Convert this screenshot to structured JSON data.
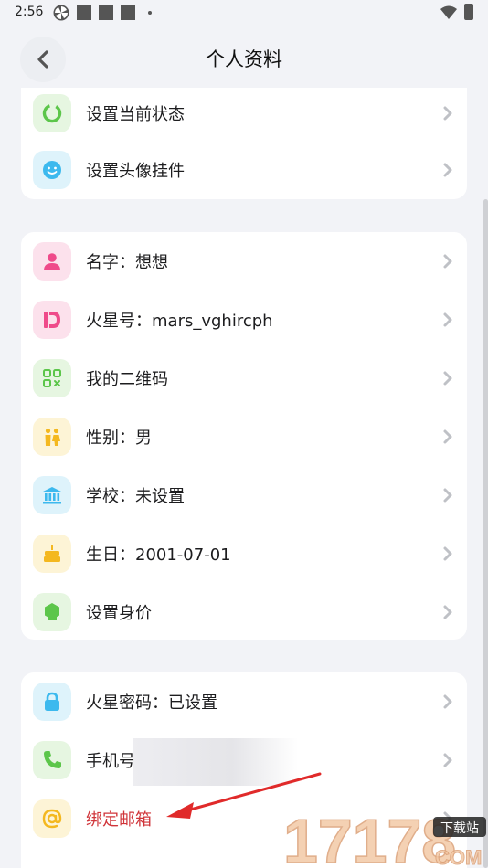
{
  "status_bar": {
    "time": "2:56"
  },
  "header": {
    "title": "个人资料"
  },
  "cards": {
    "status": [
      {
        "label": "设置当前状态",
        "icon": "status-ring-icon"
      },
      {
        "label": "设置头像挂件",
        "icon": "face-sticker-icon"
      }
    ],
    "profile": [
      {
        "label": "名字：想想",
        "icon": "person-icon"
      },
      {
        "label": "火星号：mars_vghircph",
        "icon": "mars-id-icon"
      },
      {
        "label": "我的二维码",
        "icon": "qrcode-icon"
      },
      {
        "label": "性别：男",
        "icon": "gender-icon"
      },
      {
        "label": "学校：未设置",
        "icon": "school-icon"
      },
      {
        "label": "生日：2001-07-01",
        "icon": "cake-icon"
      },
      {
        "label": "设置身价",
        "icon": "value-icon"
      }
    ],
    "security": [
      {
        "label": "火星密码：已设置",
        "icon": "lock-icon"
      },
      {
        "label": "手机号",
        "icon": "phone-icon"
      },
      {
        "label": "绑定邮箱",
        "icon": "at-sign-icon"
      }
    ]
  },
  "watermark": {
    "brand": "17178",
    "tag": "下载站",
    "suffix": "COM"
  },
  "colors": {
    "accent_red": "#d0353a",
    "background": "#f2f3f7"
  }
}
